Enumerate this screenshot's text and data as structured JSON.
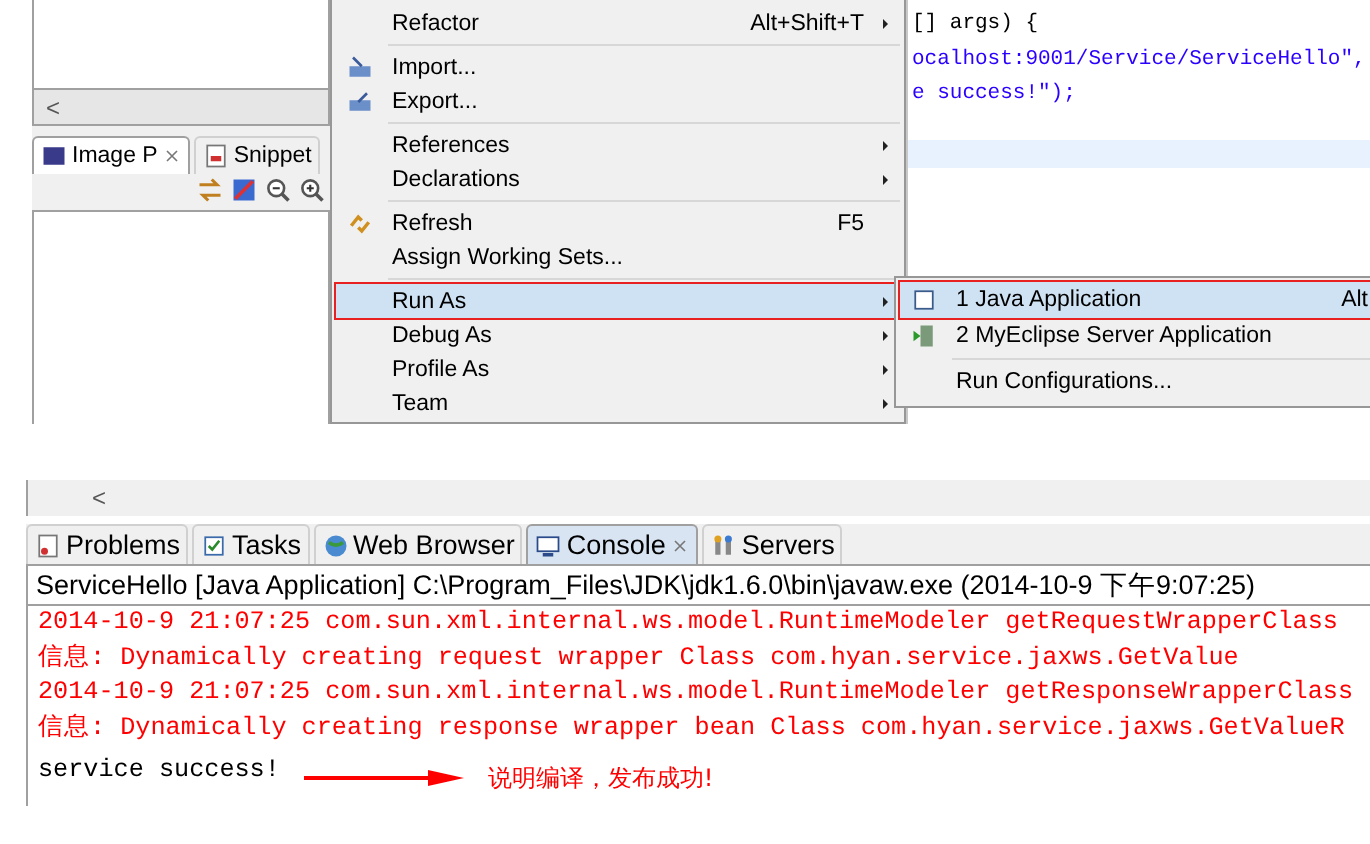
{
  "left_panel": {
    "scroll_glyph": "<",
    "tabs": [
      {
        "label": "Image P",
        "selected": true,
        "closable": true
      },
      {
        "label": "Snippet",
        "selected": false,
        "closable": false
      }
    ]
  },
  "context_menu": {
    "items": [
      {
        "kind": "item",
        "label": "Refactor",
        "shortcut": "Alt+Shift+T",
        "submenu": true,
        "selected": false
      },
      {
        "kind": "separator"
      },
      {
        "kind": "item",
        "label": "Import...",
        "submenu": false,
        "selected": false
      },
      {
        "kind": "item",
        "label": "Export...",
        "submenu": false,
        "selected": false
      },
      {
        "kind": "separator"
      },
      {
        "kind": "item",
        "label": "References",
        "submenu": true,
        "selected": false
      },
      {
        "kind": "item",
        "label": "Declarations",
        "submenu": true,
        "selected": false
      },
      {
        "kind": "separator"
      },
      {
        "kind": "item",
        "label": "Refresh",
        "shortcut": "F5",
        "submenu": false,
        "selected": false
      },
      {
        "kind": "item",
        "label": "Assign Working Sets...",
        "submenu": false,
        "selected": false
      },
      {
        "kind": "separator"
      },
      {
        "kind": "item",
        "label": "Run As",
        "submenu": true,
        "selected": true
      },
      {
        "kind": "item",
        "label": "Debug As",
        "submenu": true,
        "selected": false
      },
      {
        "kind": "item",
        "label": "Profile As",
        "submenu": true,
        "selected": false
      },
      {
        "kind": "item",
        "label": "Team",
        "submenu": true,
        "selected": false
      }
    ]
  },
  "editor": {
    "code_lines": [
      {
        "kind": "code",
        "text": "[] args) {"
      },
      {
        "kind": "string",
        "text": "ocalhost:9001/Service/ServiceHello\","
      },
      {
        "kind": "string",
        "text": "e success!\");"
      }
    ]
  },
  "submenu": {
    "items": [
      {
        "kind": "item",
        "label": "1 Java Application",
        "shortcut": "Alt",
        "selected": true
      },
      {
        "kind": "item",
        "label": "2 MyEclipse Server Application",
        "selected": false
      },
      {
        "kind": "separator"
      },
      {
        "kind": "item",
        "label": "Run Configurations...",
        "selected": false
      }
    ]
  },
  "console_view": {
    "scroll_glyph": "<",
    "tabs": [
      {
        "label": "Problems",
        "selected": false,
        "closable": false
      },
      {
        "label": "Tasks",
        "selected": false,
        "closable": false
      },
      {
        "label": "Web Browser",
        "selected": false,
        "closable": false
      },
      {
        "label": "Console",
        "selected": true,
        "closable": true
      },
      {
        "label": "Servers",
        "selected": false,
        "closable": false
      }
    ],
    "header": "ServiceHello [Java Application] C:\\Program_Files\\JDK\\jdk1.6.0\\bin\\javaw.exe (2014-10-9 下午9:07:25)",
    "lines": [
      {
        "kind": "stderr",
        "text": "2014-10-9 21:07:25 com.sun.xml.internal.ws.model.RuntimeModeler getRequestWrapperClass"
      },
      {
        "kind": "stderr",
        "text": "信息: Dynamically creating request wrapper Class com.hyan.service.jaxws.GetValue"
      },
      {
        "kind": "stderr",
        "text": "2014-10-9 21:07:25 com.sun.xml.internal.ws.model.RuntimeModeler getResponseWrapperClass"
      },
      {
        "kind": "stderr",
        "text": "信息: Dynamically creating response wrapper bean Class com.hyan.service.jaxws.GetValueR"
      },
      {
        "kind": "stdout",
        "text": "service success!",
        "annotation": "说明编译，发布成功!"
      }
    ]
  }
}
